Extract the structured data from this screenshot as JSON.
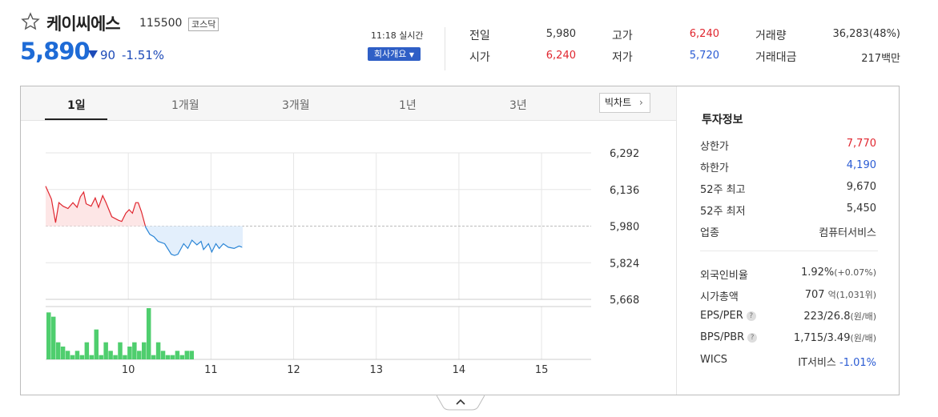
{
  "header": {
    "name": "케이씨에스",
    "code": "115500",
    "market": "코스닥",
    "price": "5,890",
    "change": "90",
    "change_pct": "-1.51%",
    "realtime": "11:18 실시간",
    "company_button": "회사개요",
    "colors": {
      "up": "#e0262f",
      "down": "#2a5bd3",
      "price": "#1e6bd6"
    }
  },
  "quote": [
    {
      "label": "전일",
      "value": "5,980",
      "color": "dark"
    },
    {
      "label": "고가",
      "value": "6,240",
      "color": "red"
    },
    {
      "label": "거래량",
      "value": "36,283(48%)",
      "color": "dark"
    },
    {
      "label": "시가",
      "value": "6,240",
      "color": "red"
    },
    {
      "label": "저가",
      "value": "5,720",
      "color": "blue"
    },
    {
      "label": "거래대금",
      "value": "217백만",
      "color": "dark"
    }
  ],
  "tabs": [
    "1일",
    "1개월",
    "3개월",
    "1년",
    "3년"
  ],
  "big_chart_button": "빅차트",
  "invest": {
    "title": "투자정보",
    "rows": [
      {
        "label": "상한가",
        "value": "7,770",
        "color": "red"
      },
      {
        "label": "하한가",
        "value": "4,190",
        "color": "blue"
      },
      {
        "label": "52주 최고",
        "value": "9,670",
        "color": "dark"
      },
      {
        "label": "52주 최저",
        "value": "5,450",
        "color": "dark"
      },
      {
        "label": "업종",
        "value": "컴퓨터서비스",
        "color": "dark"
      },
      {
        "label": "외국인비율",
        "value": "1.92%",
        "sub": "(+0.07%)",
        "color": "dark"
      },
      {
        "label": "시가총액",
        "value": "707",
        "sub": "억(1,031위)",
        "color": "dark"
      },
      {
        "label": "EPS/PER",
        "value": "223/26.8",
        "sub": "(원/배)",
        "color": "dark",
        "help": "?"
      },
      {
        "label": "BPS/PBR",
        "value": "1,715/3.49",
        "sub": "(원/배)",
        "color": "dark",
        "help": "?"
      },
      {
        "label": "WICS",
        "value": "IT서비스",
        "sub": "-1.01%",
        "color": "dark"
      }
    ]
  },
  "chart_data": {
    "type": "line",
    "x_ticks": [
      "10",
      "11",
      "12",
      "13",
      "14",
      "15"
    ],
    "y_ticks": [
      "6,292",
      "6,136",
      "5,980",
      "5,824",
      "5,668"
    ],
    "ylim": [
      5668,
      6292
    ],
    "x_range": [
      9.0,
      15.6
    ],
    "reference_price": 5980,
    "series": [
      {
        "values": [
          [
            9.0,
            6150
          ],
          [
            9.07,
            6095
          ],
          [
            9.12,
            5995
          ],
          [
            9.16,
            6080
          ],
          [
            9.21,
            6065
          ],
          [
            9.27,
            6055
          ],
          [
            9.33,
            6080
          ],
          [
            9.38,
            6060
          ],
          [
            9.42,
            6105
          ],
          [
            9.46,
            6125
          ],
          [
            9.49,
            6075
          ],
          [
            9.55,
            6065
          ],
          [
            9.6,
            6100
          ],
          [
            9.64,
            6060
          ],
          [
            9.69,
            6110
          ],
          [
            9.73,
            6080
          ],
          [
            9.8,
            6020
          ],
          [
            9.88,
            6005
          ],
          [
            9.92,
            6000
          ],
          [
            9.97,
            6035
          ],
          [
            10.01,
            6050
          ],
          [
            10.05,
            6035
          ],
          [
            10.09,
            6080
          ],
          [
            10.12,
            6080
          ],
          [
            10.16,
            6040
          ],
          [
            10.21,
            5975
          ],
          [
            10.26,
            5945
          ],
          [
            10.31,
            5935
          ],
          [
            10.36,
            5915
          ],
          [
            10.44,
            5905
          ],
          [
            10.52,
            5860
          ],
          [
            10.56,
            5855
          ],
          [
            10.6,
            5860
          ],
          [
            10.67,
            5905
          ],
          [
            10.72,
            5885
          ],
          [
            10.77,
            5920
          ],
          [
            10.83,
            5900
          ],
          [
            10.88,
            5915
          ],
          [
            10.91,
            5880
          ],
          [
            10.97,
            5905
          ],
          [
            11.01,
            5870
          ],
          [
            11.06,
            5905
          ],
          [
            11.1,
            5885
          ],
          [
            11.15,
            5905
          ],
          [
            11.21,
            5890
          ],
          [
            11.28,
            5885
          ],
          [
            11.34,
            5895
          ],
          [
            11.38,
            5890
          ]
        ]
      }
    ],
    "volume": [
      11,
      10,
      4,
      3,
      2,
      1,
      2,
      1,
      4,
      1,
      7,
      1,
      4,
      2,
      1,
      4,
      1,
      3,
      4,
      2,
      4,
      12,
      1,
      4,
      2,
      1,
      1,
      2,
      1,
      2,
      2
    ]
  }
}
